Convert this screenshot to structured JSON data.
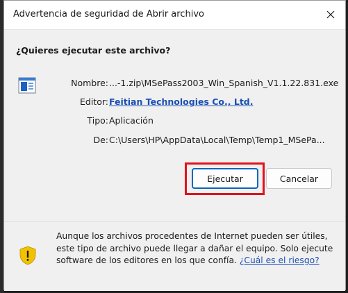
{
  "window": {
    "title": "Advertencia de seguridad de Abrir archivo",
    "close_glyph": "✕"
  },
  "question": "¿Quieres ejecutar este archivo?",
  "file_info": {
    "name_label": "Nombre:",
    "name_value": "...-1.zip\\MSePass2003_Win_Spanish_V1.1.22.831.exe",
    "publisher_label": "Editor:",
    "publisher_value": "Feitian Technologies Co., Ltd.",
    "type_label": "Tipo:",
    "type_value": "Aplicación",
    "from_label": "De:",
    "from_value": "C:\\Users\\HP\\AppData\\Local\\Temp\\Temp1_MSePa..."
  },
  "buttons": {
    "run_label": "Ejecutar",
    "cancel_label": "Cancelar"
  },
  "warning": {
    "text": "Aunque los archivos procedentes de Internet pueden ser útiles, este tipo de archivo puede llegar a dañar el equipo. Solo ejecute software de los editores en los que confía.",
    "link_text": "¿Cuál es el riesgo?"
  },
  "colors": {
    "highlight": "#e0121a",
    "link": "#1a4fb3",
    "shield": "#f2c200",
    "primary_border": "#0067c0"
  },
  "icons": {
    "file": "application-file-icon",
    "warning": "warning-shield-icon",
    "close": "close-icon"
  }
}
